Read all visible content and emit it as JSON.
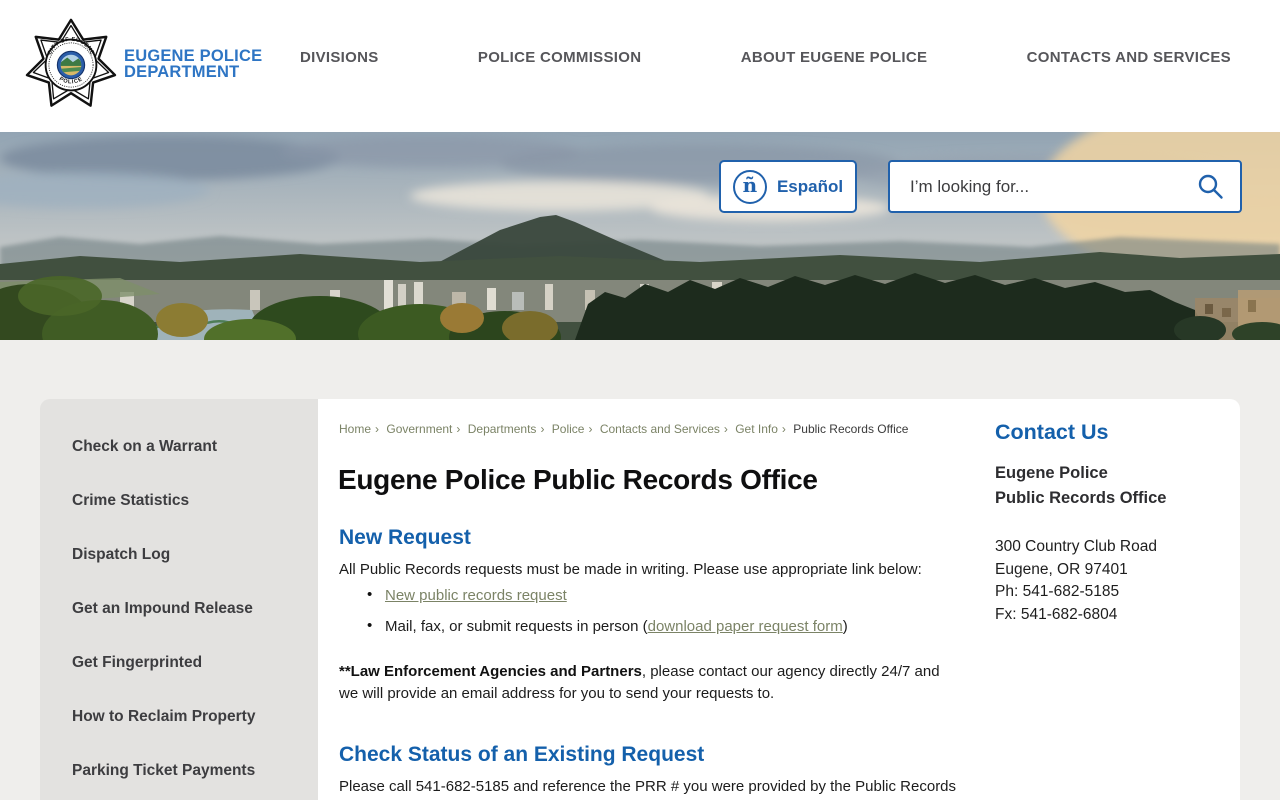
{
  "header": {
    "wordmark_line1": "EUGENE POLICE",
    "wordmark_line2": "DEPARTMENT",
    "nav": [
      {
        "label": "DIVISIONS"
      },
      {
        "label": "POLICE COMMISSION"
      },
      {
        "label": "ABOUT EUGENE POLICE"
      },
      {
        "label": "CONTACTS AND SERVICES"
      }
    ]
  },
  "hero": {
    "espanol_label": "Español",
    "espanol_icon_glyph": "ñ",
    "search_placeholder": "I’m looking for..."
  },
  "sidebar": {
    "items": [
      {
        "label": "Check on a Warrant"
      },
      {
        "label": "Crime Statistics"
      },
      {
        "label": "Dispatch Log"
      },
      {
        "label": "Get an Impound Release"
      },
      {
        "label": "Get Fingerprinted"
      },
      {
        "label": "How to Reclaim Property"
      },
      {
        "label": "Parking Ticket Payments"
      }
    ]
  },
  "breadcrumb": {
    "links": [
      "Home",
      "Government",
      "Departments",
      "Police",
      "Contacts and Services",
      "Get Info"
    ],
    "separator": "›",
    "current": "Public Records Office"
  },
  "main": {
    "title": "Eugene Police Public Records Office",
    "new_request": {
      "heading": "New Request",
      "intro": "All Public Records  requests must be made in writing. Please use appropriate link below:",
      "bullet1_link": "New public records request",
      "bullet2_pre": "Mail, fax, or submit requests in person (",
      "bullet2_link": "download paper request form",
      "bullet2_post": ")",
      "note_bold": "**Law Enforcement Agencies and Partners",
      "note_rest": ", please contact our agency directly 24/7 and we will provide an email address for you to send your requests to."
    },
    "check_status": {
      "heading": "Check Status of an Existing Request",
      "body": "Please call 541-682-5185 and reference the PRR # you were provided by the Public Records"
    }
  },
  "contact": {
    "heading": "Contact Us",
    "org_line1": "Eugene Police",
    "org_line2": "Public Records Office",
    "address_line1": "300 Country Club Road",
    "address_line2": "Eugene, OR 97401",
    "phone": "Ph: 541-682-5185",
    "fax": "Fx: 541-682-6804"
  },
  "colors": {
    "accent_blue": "#2061ac",
    "heading_blue": "#1460ab",
    "wordmark_blue": "#2e75c4",
    "link_olive": "#7b8366",
    "nav_gray": "#56565a",
    "sidebar_bg": "#e3e2e0",
    "page_bg": "#efeeec"
  }
}
